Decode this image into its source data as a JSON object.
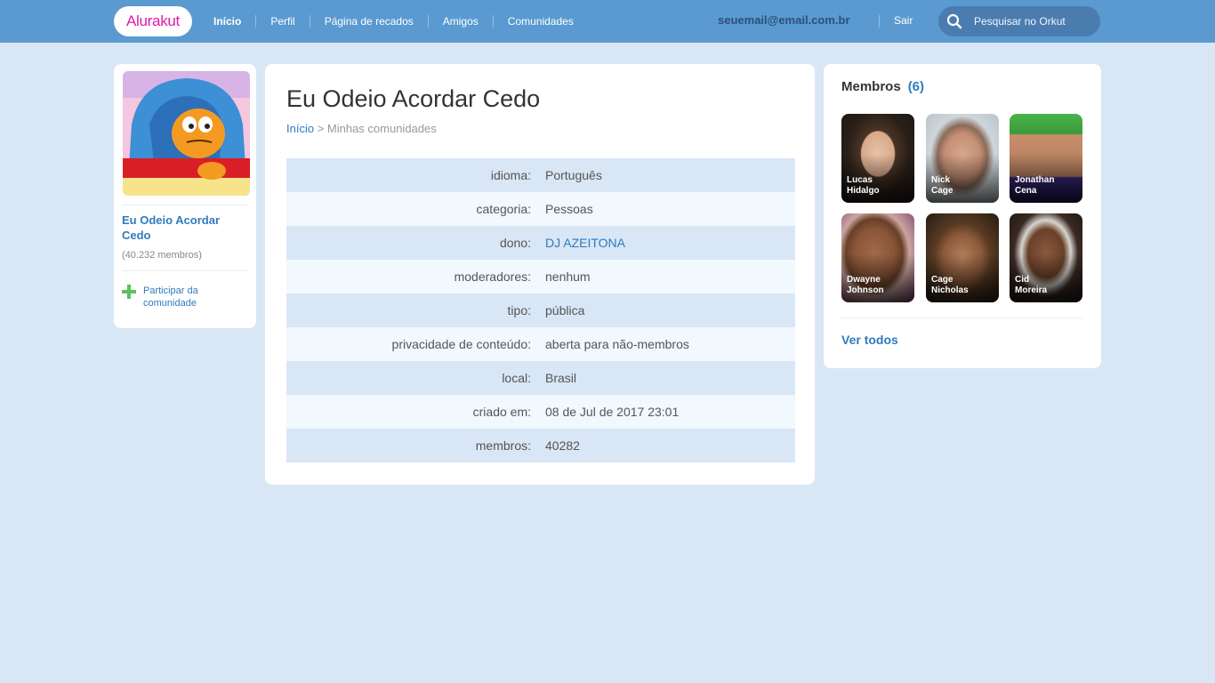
{
  "header": {
    "logo_text": "Alurakut",
    "nav": [
      {
        "label": "Início"
      },
      {
        "label": "Perfil"
      },
      {
        "label": "Página de recados"
      },
      {
        "label": "Amigos"
      },
      {
        "label": "Comunidades"
      }
    ],
    "user_email": "seuemail@email.com.br",
    "logout_label": "Sair",
    "search_placeholder": "Pesquisar no Orkut"
  },
  "sidebar": {
    "community_name": "Eu Odeio Acordar Cedo",
    "member_count_text": "(40.232 membros)",
    "join_label": "Participar da comunidade"
  },
  "main": {
    "title": "Eu Odeio Acordar Cedo",
    "breadcrumb_home": "Início",
    "breadcrumb_rest": " > Minhas comunidades",
    "info": [
      {
        "label": "idioma:",
        "value": "Português"
      },
      {
        "label": "categoria:",
        "value": "Pessoas"
      },
      {
        "label": "dono:",
        "value": "DJ AZEITONA"
      },
      {
        "label": "moderadores:",
        "value": "nenhum"
      },
      {
        "label": "tipo:",
        "value": "pública"
      },
      {
        "label": "privacidade de conteúdo:",
        "value": "aberta para não-membros"
      },
      {
        "label": "local:",
        "value": "Brasil"
      },
      {
        "label": "criado em:",
        "value": "08 de Jul de 2017 23:01"
      },
      {
        "label": "membros:",
        "value": "40282"
      }
    ]
  },
  "members": {
    "title": "Membros",
    "count": "(6)",
    "list": [
      {
        "first": "Lucas",
        "last": "Hidalgo"
      },
      {
        "first": "Nick",
        "last": "Cage"
      },
      {
        "first": "Jonathan",
        "last": "Cena"
      },
      {
        "first": "Dwayne",
        "last": "Johnson"
      },
      {
        "first": "Cage",
        "last": "Nicholas"
      },
      {
        "first": "Cid",
        "last": "Moreira"
      }
    ],
    "see_all_label": "Ver todos"
  }
}
